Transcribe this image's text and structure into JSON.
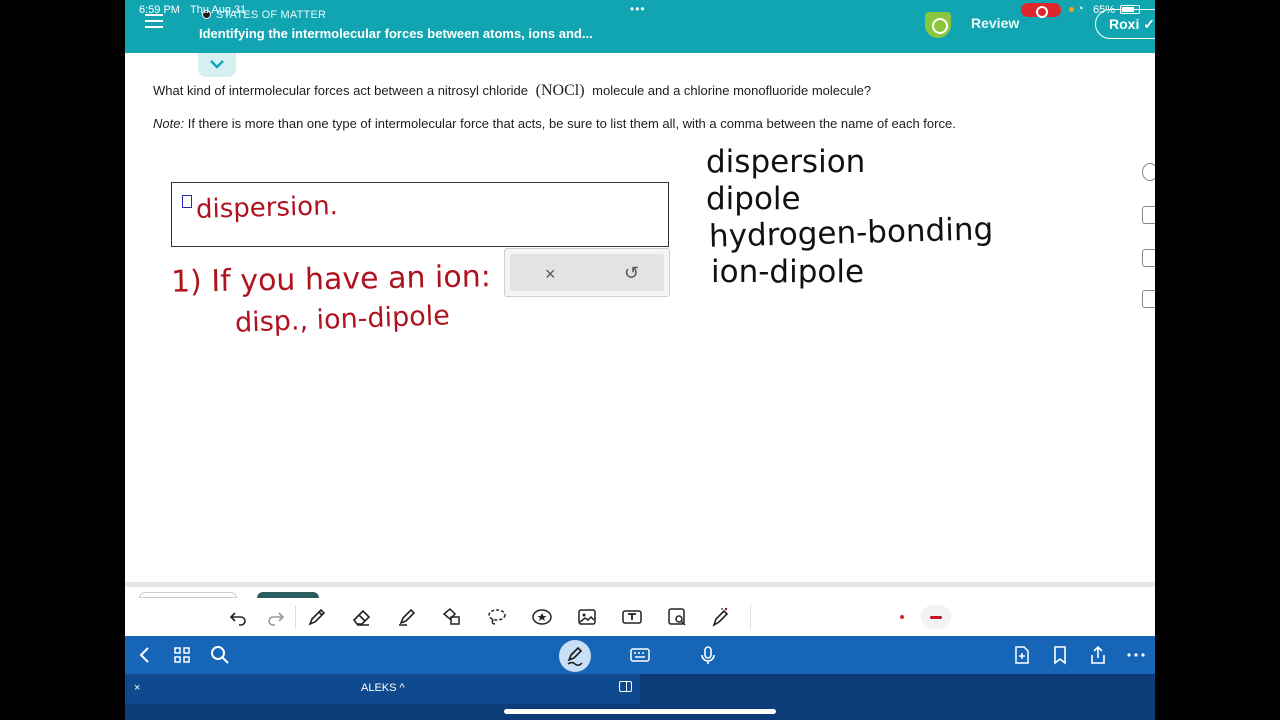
{
  "status": {
    "time": "6:59 PM",
    "date": "Thu Aug 31",
    "battery": "65%"
  },
  "header": {
    "topic": "STATES OF MATTER",
    "subtitle": "Identifying the intermolecular forces between atoms, ions and...",
    "review": "Review",
    "user": "Roxi"
  },
  "question": {
    "before": "What kind of intermolecular forces act between a nitrosyl chloride",
    "formula": "(NOCl)",
    "after": "molecule and a chlorine monofluoride molecule?",
    "note_label": "Note:",
    "note_text": "If there is more than one type of intermolecular force that acts, be sure to list them all, with a comma between the name of each force."
  },
  "answer": {
    "typed": "dispersion."
  },
  "popup": {
    "clear": "×",
    "undo": "↺"
  },
  "handwriting": {
    "red_line1": "1) If you have an ion:",
    "red_line2": "disp., ion-dipole",
    "list": [
      "dispersion",
      "dipole",
      "hydrogen-bonding",
      "ion-dipole"
    ]
  },
  "bottombar": {
    "close": "×",
    "app": "ALEKS ^"
  },
  "colors": {
    "header": "#10a5b1",
    "ink_red": "#b01320",
    "navbar": "#1665b7",
    "bottombar": "#0d3c78"
  }
}
